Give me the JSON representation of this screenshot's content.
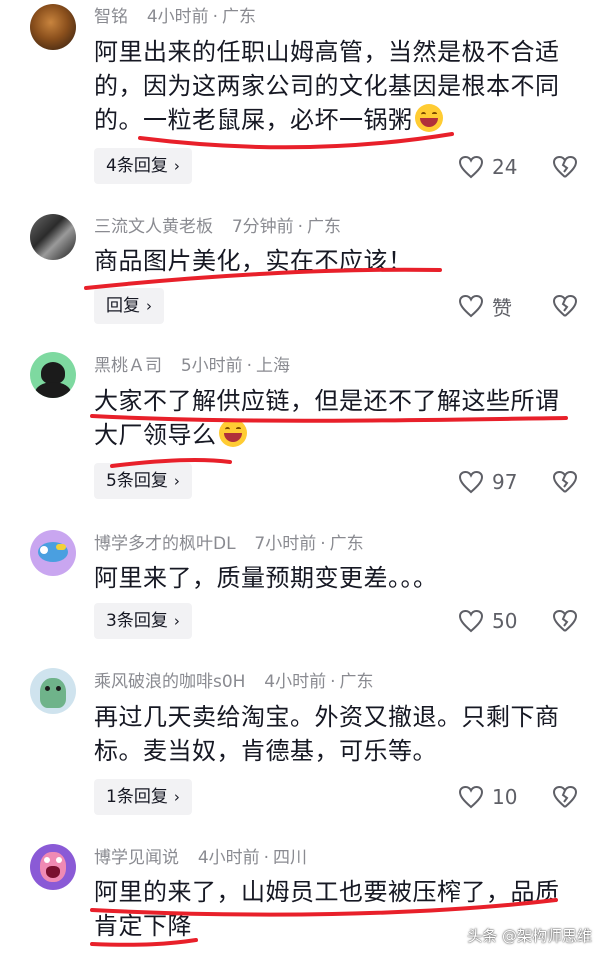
{
  "comments": [
    {
      "username": "智铭",
      "time": "4小时前",
      "location": "广东",
      "text_lines": [
        "阿里出来的任职山姆高管，当然是极不合适",
        "的，因为这两家公司的文化基因是根本不同",
        "的。一粒老鼠屎，必坏一锅粥"
      ],
      "has_emoji": true,
      "emoji": "laughing-emoji",
      "reply_label": "4条回复",
      "likes": "24"
    },
    {
      "username": "三流文人黄老板",
      "time": "7分钟前",
      "location": "广东",
      "text_lines": [
        "商品图片美化，实在不应该！"
      ],
      "has_emoji": false,
      "reply_label": "回复",
      "likes": "赞"
    },
    {
      "username": "黑桃Ａ司",
      "time": "5小时前",
      "location": "上海",
      "text_lines": [
        "大家不了解供应链，但是还不了解这些所谓",
        "大厂领导么"
      ],
      "has_emoji": true,
      "emoji": "grinning-emoji",
      "reply_label": "5条回复",
      "likes": "97"
    },
    {
      "username": "博学多才的枫叶DL",
      "time": "7小时前",
      "location": "广东",
      "text_lines": [
        "阿里来了，质量预期变更差。。。"
      ],
      "has_emoji": false,
      "reply_label": "3条回复",
      "likes": "50"
    },
    {
      "username": "乘风破浪的咖啡s0H",
      "time": "4小时前",
      "location": "广东",
      "text_lines": [
        "再过几天卖给淘宝。外资又撤退。只剩下商",
        "标。麦当奴，肯德基，可乐等。"
      ],
      "has_emoji": false,
      "reply_label": "1条回复",
      "likes": "10"
    },
    {
      "username": "博学见闻说",
      "time": "4小时前",
      "location": "四川",
      "text_lines": [
        "阿里的来了，山姆员工也要被压榨了，品质",
        "肯定下降"
      ],
      "has_emoji": false
    }
  ],
  "separator": "·",
  "watermark": "头条 @架构师思维",
  "colors": {
    "underline": "#e8202a",
    "meta": "#8a8b91",
    "text": "#161823",
    "reply_bg": "#f2f2f4"
  }
}
